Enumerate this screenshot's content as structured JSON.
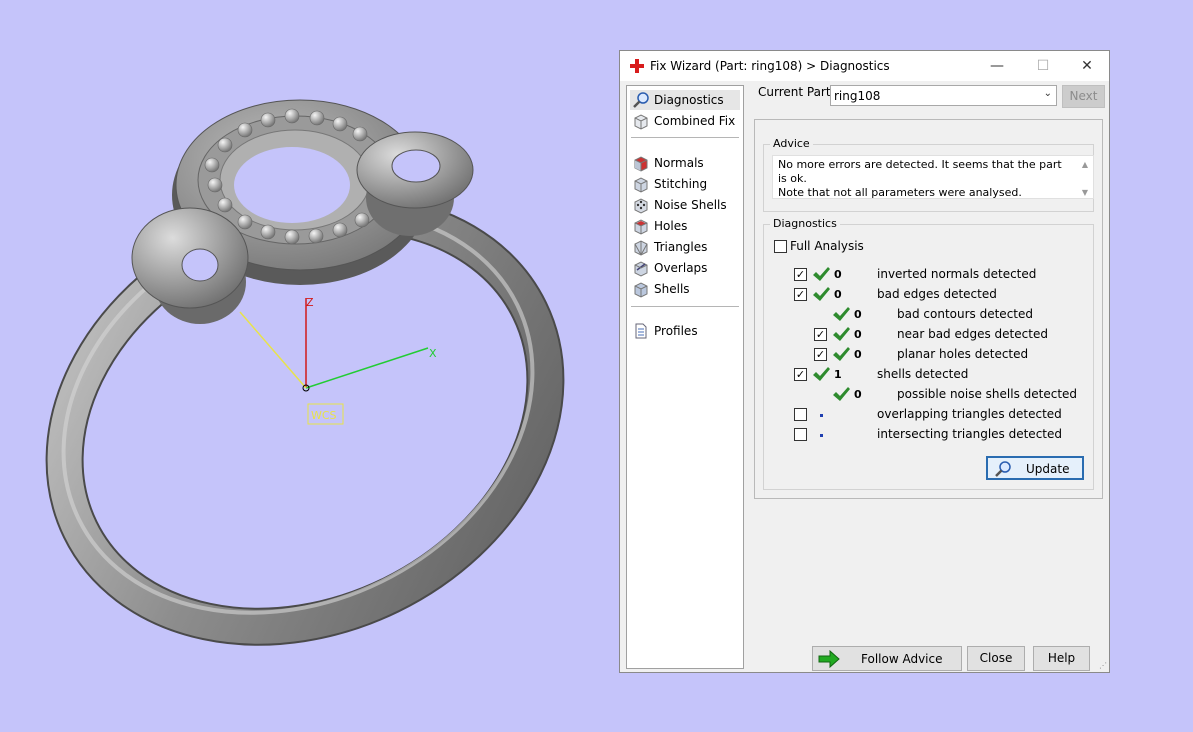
{
  "viewport": {
    "axis_z": "Z",
    "axis_x": "X",
    "wcs_label": "WCS",
    "colors": {
      "background": "#c5c4fa",
      "ring": "#8f8f8f",
      "axis_z": "#d11a1a",
      "axis_x": "#22cc33",
      "axis_y": "#e8e34a"
    }
  },
  "dialog": {
    "title": "Fix Wizard (Part: ring108) > Diagnostics",
    "window_controls": {
      "minimize": "—",
      "maximize": "☐",
      "close": "✕"
    },
    "nav": {
      "items": [
        {
          "label": "Diagnostics",
          "icon": "magnifier-icon",
          "selected": true
        },
        {
          "label": "Combined Fix",
          "icon": "cube-icon"
        },
        {
          "label": "Normals",
          "icon": "cube-red-icon"
        },
        {
          "label": "Stitching",
          "icon": "cube-icon"
        },
        {
          "label": "Noise Shells",
          "icon": "dotted-cube-icon"
        },
        {
          "label": "Holes",
          "icon": "cube-hole-icon"
        },
        {
          "label": "Triangles",
          "icon": "triangles-icon"
        },
        {
          "label": "Overlaps",
          "icon": "overlap-icon"
        },
        {
          "label": "Shells",
          "icon": "shell-icon"
        },
        {
          "label": "Profiles",
          "icon": "document-icon"
        }
      ]
    },
    "current_part": {
      "label": "Current Part:",
      "value": "ring108"
    },
    "next_label": "Next",
    "advice": {
      "title": "Advice",
      "text_line1": "No more errors are detected. It seems that the part is ok.",
      "text_line2": "Note that not all parameters were analysed."
    },
    "diagnostics": {
      "title": "Diagnostics",
      "full_analysis_label": "Full Analysis",
      "full_analysis_checked": false,
      "rows": [
        {
          "checked": true,
          "status": "ok",
          "count": "0",
          "label": "inverted normals detected"
        },
        {
          "checked": true,
          "status": "ok",
          "count": "0",
          "label": "bad edges detected"
        },
        {
          "status": "ok",
          "count": "0",
          "label": "bad contours detected"
        },
        {
          "checked": true,
          "status": "ok",
          "count": "0",
          "label": "near bad edges detected"
        },
        {
          "checked": true,
          "status": "ok",
          "count": "0",
          "label": "planar holes detected"
        },
        {
          "checked": true,
          "status": "ok",
          "count": "1",
          "label": "shells detected"
        },
        {
          "status": "ok",
          "count": "0",
          "label": "possible noise shells detected"
        },
        {
          "checked": false,
          "status": "none",
          "count": "",
          "label": "overlapping triangles detected"
        },
        {
          "checked": false,
          "status": "none",
          "count": "",
          "label": "intersecting triangles detected"
        }
      ],
      "update_label": "Update"
    },
    "footer": {
      "follow_advice": "Follow Advice",
      "close": "Close",
      "help": "Help"
    },
    "colors": {
      "check": "#2e8b2e",
      "arrow": "#22aa22",
      "title_icon": "#d81c1c"
    }
  }
}
